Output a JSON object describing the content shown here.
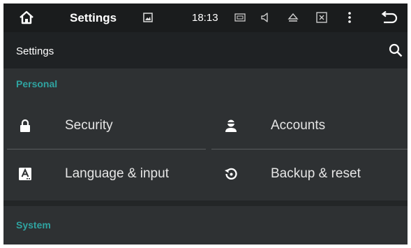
{
  "status_bar": {
    "title": "Settings",
    "time": "18:13",
    "icons": [
      "home-icon",
      "gallery-icon",
      "card-icon",
      "volume-icon",
      "eject-icon",
      "close-box-icon",
      "more-vert-icon",
      "back-icon"
    ]
  },
  "app_bar": {
    "title": "Settings",
    "search_icon": "search-icon"
  },
  "sections": [
    {
      "label": "Personal",
      "items": [
        {
          "label": "Security",
          "icon": "lock-icon"
        },
        {
          "label": "Accounts",
          "icon": "account-icon"
        },
        {
          "label": "Language & input",
          "icon": "language-icon"
        },
        {
          "label": "Backup & reset",
          "icon": "backup-icon"
        }
      ]
    },
    {
      "label": "System",
      "items": []
    }
  ],
  "colors": {
    "accent": "#2fa3a0",
    "background": "#2e3133",
    "status_bar": "#1a1c1d"
  }
}
